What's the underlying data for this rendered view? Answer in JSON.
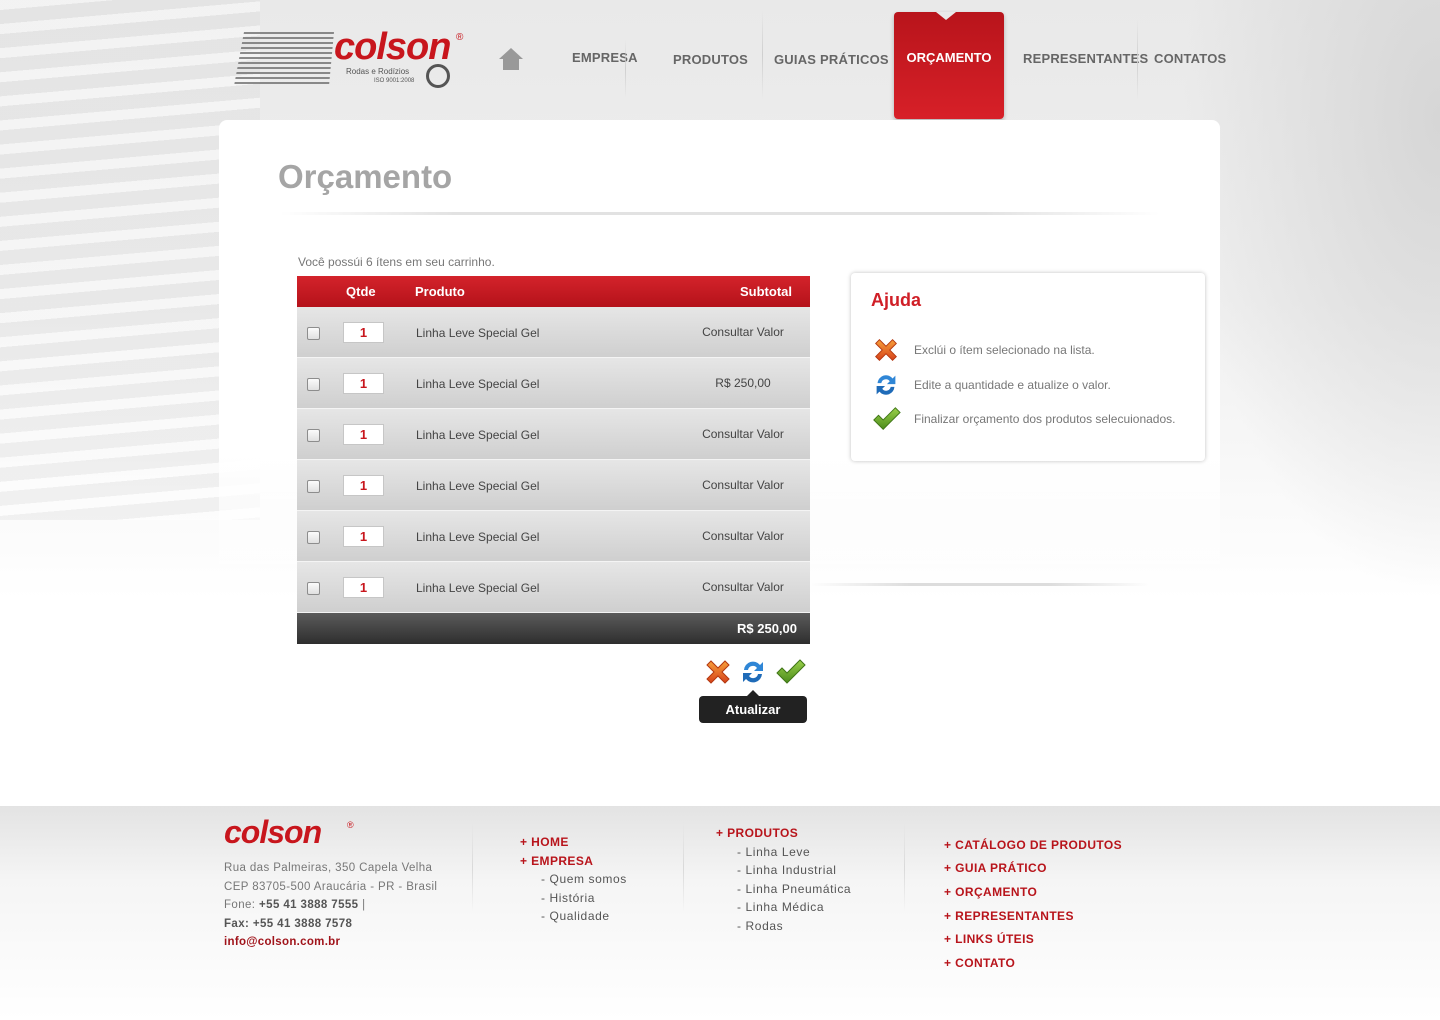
{
  "header": {
    "brand": "colson",
    "reg_mark": "®",
    "tagline": "Rodas e Rodízios",
    "iso": "ISO 9001:2008",
    "nav": {
      "empresa": "EMPRESA",
      "produtos": "PRODUTOS",
      "guias": "GUIAS PRÁTICOS",
      "orcamento": "ORÇAMENTO",
      "representantes": "REPRESENTANTES",
      "contatos": "CONTATOS"
    },
    "active_nav": "ORÇAMENTO"
  },
  "page": {
    "title": "Orçamento",
    "cart_note": "Você possúi 6 ítens em seu carrinho."
  },
  "cart": {
    "columns": {
      "qtde": "Qtde",
      "produto": "Produto",
      "subtotal": "Subtotal"
    },
    "rows": [
      {
        "qty": "1",
        "product": "Linha Leve Special Gel",
        "subtotal": "Consultar Valor"
      },
      {
        "qty": "1",
        "product": "Linha Leve Special Gel",
        "subtotal": "R$ 250,00"
      },
      {
        "qty": "1",
        "product": "Linha Leve Special Gel",
        "subtotal": "Consultar Valor"
      },
      {
        "qty": "1",
        "product": "Linha Leve Special Gel",
        "subtotal": "Consultar Valor"
      },
      {
        "qty": "1",
        "product": "Linha Leve Special Gel",
        "subtotal": "Consultar Valor"
      },
      {
        "qty": "1",
        "product": "Linha Leve Special Gel",
        "subtotal": "Consultar Valor"
      }
    ],
    "total": "R$ 250,00",
    "actions": [
      "delete-icon",
      "refresh-icon",
      "checkmark-icon"
    ],
    "tooltip": "Atualizar"
  },
  "help": {
    "title": "Ajuda",
    "items": [
      {
        "icon": "delete-icon",
        "text": "Exclúi o ítem selecionado na lista."
      },
      {
        "icon": "refresh-icon",
        "text": "Edite a quantidade e atualize o valor."
      },
      {
        "icon": "checkmark-icon",
        "text": "Finalizar orçamento dos produtos selecuionados."
      }
    ]
  },
  "footer": {
    "brand": "colson",
    "reg_mark": "®",
    "address1": "Rua das Palmeiras, 350 Capela Velha",
    "address2": "CEP 83705-500 Araucária - PR - Brasil",
    "phone_label": "Fone:",
    "phone": "+55 41 3888 7555",
    "phone_sep": "|",
    "fax_label": "Fax:",
    "fax": "+55 41 3888 7578",
    "email": "info@colson.com.br",
    "col1": {
      "home": "+ HOME",
      "empresa": "+ EMPRESA",
      "subs": [
        "- Quem somos",
        "- História",
        "- Qualidade"
      ]
    },
    "col2": {
      "produtos": "+ PRODUTOS",
      "subs": [
        "- Linha Leve",
        "- Linha Industrial",
        "- Linha Pneumática",
        "- Linha Médica",
        "- Rodas"
      ]
    },
    "col3": [
      "+ CATÁLOGO DE PRODUTOS",
      "+ GUIA PRÁTICO",
      "+ ORÇAMENTO",
      "+ REPRESENTANTES",
      "+ LINKS ÚTEIS",
      "+ CONTATO"
    ]
  },
  "colors": {
    "brand_red": "#c8161d",
    "header_red": "#d4232b",
    "total_dark": "#2e2e2e"
  }
}
